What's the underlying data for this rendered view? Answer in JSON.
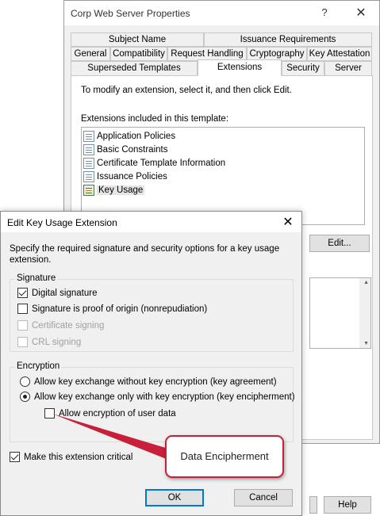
{
  "background_window": {
    "title": "Corp Web Server Properties",
    "help_glyph": "?",
    "close_glyph": "✕",
    "tabs_row1": [
      "Subject Name",
      "Issuance Requirements"
    ],
    "tabs_row2": [
      "General",
      "Compatibility",
      "Request Handling",
      "Cryptography",
      "Key Attestation"
    ],
    "tabs_row3": [
      "Superseded Templates",
      "Extensions",
      "Security",
      "Server"
    ],
    "active_tab": "Extensions",
    "instruction": "To modify an extension, select it, and then click Edit.",
    "list_label": "Extensions included in this template:",
    "extensions": [
      "Application Policies",
      "Basic Constraints",
      "Certificate Template Information",
      "Issuance Policies",
      "Key Usage"
    ],
    "selected_extension": "Key Usage",
    "edit_button": "Edit...",
    "help_button": "Help"
  },
  "dialog": {
    "title": "Edit Key Usage Extension",
    "close_glyph": "✕",
    "description": "Specify the required signature and security options for a key usage extension.",
    "signature_group": {
      "title": "Signature",
      "options": [
        {
          "label": "Digital signature",
          "checked": true,
          "enabled": true
        },
        {
          "label": "Signature is proof of origin (nonrepudiation)",
          "checked": false,
          "enabled": true
        },
        {
          "label": "Certificate signing",
          "checked": false,
          "enabled": false
        },
        {
          "label": "CRL signing",
          "checked": false,
          "enabled": false
        }
      ]
    },
    "encryption_group": {
      "title": "Encryption",
      "radio_agreement": "Allow key exchange without key encryption (key agreement)",
      "radio_encipherment": "Allow key exchange only with key encryption (key encipherment)",
      "selected": "encipherment",
      "user_data_checkbox": "Allow encryption of user data",
      "user_data_checked": false
    },
    "critical_checkbox": "Make this extension critical",
    "critical_checked": true,
    "ok_button": "OK",
    "cancel_button": "Cancel"
  },
  "callout": {
    "text": "Data Encipherment",
    "color": "#c8203a"
  },
  "colors": {
    "window_bg": "#f0f0f0",
    "focus_blue": "#0078d7"
  }
}
